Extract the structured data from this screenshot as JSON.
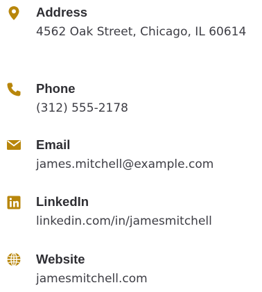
{
  "accent_color": "#b8860b",
  "contacts": [
    {
      "icon": "map-pin-icon",
      "label": "Address",
      "value": "4562 Oak Street, Chicago, IL 60614"
    },
    {
      "icon": "phone-icon",
      "label": "Phone",
      "value": "(312) 555-2178"
    },
    {
      "icon": "envelope-icon",
      "label": "Email",
      "value": "james.mitchell@example.com"
    },
    {
      "icon": "linkedin-icon",
      "label": "LinkedIn",
      "value": "linkedin.com/in/jamesmitchell"
    },
    {
      "icon": "globe-icon",
      "label": "Website",
      "value": "jamesmitchell.com"
    }
  ]
}
